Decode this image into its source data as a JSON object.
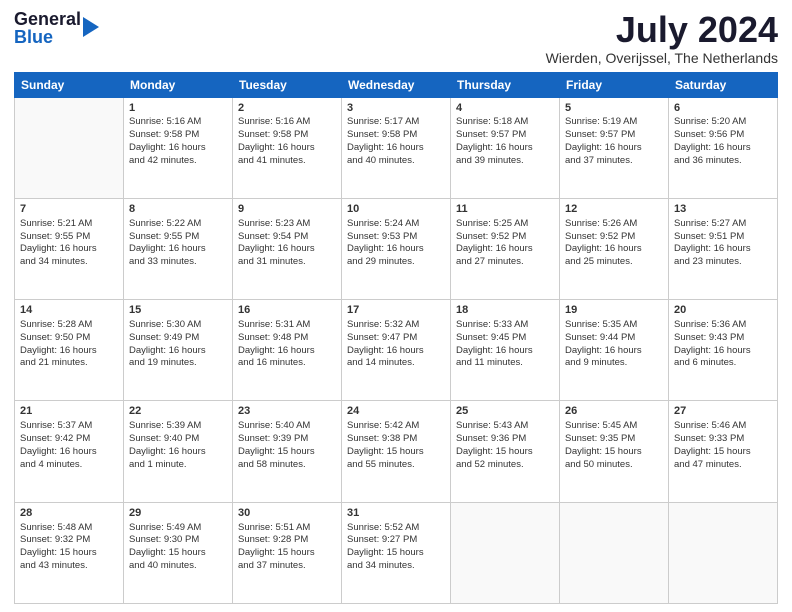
{
  "logo": {
    "general": "General",
    "blue": "Blue"
  },
  "title": "July 2024",
  "subtitle": "Wierden, Overijssel, The Netherlands",
  "days_of_week": [
    "Sunday",
    "Monday",
    "Tuesday",
    "Wednesday",
    "Thursday",
    "Friday",
    "Saturday"
  ],
  "weeks": [
    [
      {
        "day": "",
        "content": ""
      },
      {
        "day": "1",
        "content": "Sunrise: 5:16 AM\nSunset: 9:58 PM\nDaylight: 16 hours\nand 42 minutes."
      },
      {
        "day": "2",
        "content": "Sunrise: 5:16 AM\nSunset: 9:58 PM\nDaylight: 16 hours\nand 41 minutes."
      },
      {
        "day": "3",
        "content": "Sunrise: 5:17 AM\nSunset: 9:58 PM\nDaylight: 16 hours\nand 40 minutes."
      },
      {
        "day": "4",
        "content": "Sunrise: 5:18 AM\nSunset: 9:57 PM\nDaylight: 16 hours\nand 39 minutes."
      },
      {
        "day": "5",
        "content": "Sunrise: 5:19 AM\nSunset: 9:57 PM\nDaylight: 16 hours\nand 37 minutes."
      },
      {
        "day": "6",
        "content": "Sunrise: 5:20 AM\nSunset: 9:56 PM\nDaylight: 16 hours\nand 36 minutes."
      }
    ],
    [
      {
        "day": "7",
        "content": "Sunrise: 5:21 AM\nSunset: 9:55 PM\nDaylight: 16 hours\nand 34 minutes."
      },
      {
        "day": "8",
        "content": "Sunrise: 5:22 AM\nSunset: 9:55 PM\nDaylight: 16 hours\nand 33 minutes."
      },
      {
        "day": "9",
        "content": "Sunrise: 5:23 AM\nSunset: 9:54 PM\nDaylight: 16 hours\nand 31 minutes."
      },
      {
        "day": "10",
        "content": "Sunrise: 5:24 AM\nSunset: 9:53 PM\nDaylight: 16 hours\nand 29 minutes."
      },
      {
        "day": "11",
        "content": "Sunrise: 5:25 AM\nSunset: 9:52 PM\nDaylight: 16 hours\nand 27 minutes."
      },
      {
        "day": "12",
        "content": "Sunrise: 5:26 AM\nSunset: 9:52 PM\nDaylight: 16 hours\nand 25 minutes."
      },
      {
        "day": "13",
        "content": "Sunrise: 5:27 AM\nSunset: 9:51 PM\nDaylight: 16 hours\nand 23 minutes."
      }
    ],
    [
      {
        "day": "14",
        "content": "Sunrise: 5:28 AM\nSunset: 9:50 PM\nDaylight: 16 hours\nand 21 minutes."
      },
      {
        "day": "15",
        "content": "Sunrise: 5:30 AM\nSunset: 9:49 PM\nDaylight: 16 hours\nand 19 minutes."
      },
      {
        "day": "16",
        "content": "Sunrise: 5:31 AM\nSunset: 9:48 PM\nDaylight: 16 hours\nand 16 minutes."
      },
      {
        "day": "17",
        "content": "Sunrise: 5:32 AM\nSunset: 9:47 PM\nDaylight: 16 hours\nand 14 minutes."
      },
      {
        "day": "18",
        "content": "Sunrise: 5:33 AM\nSunset: 9:45 PM\nDaylight: 16 hours\nand 11 minutes."
      },
      {
        "day": "19",
        "content": "Sunrise: 5:35 AM\nSunset: 9:44 PM\nDaylight: 16 hours\nand 9 minutes."
      },
      {
        "day": "20",
        "content": "Sunrise: 5:36 AM\nSunset: 9:43 PM\nDaylight: 16 hours\nand 6 minutes."
      }
    ],
    [
      {
        "day": "21",
        "content": "Sunrise: 5:37 AM\nSunset: 9:42 PM\nDaylight: 16 hours\nand 4 minutes."
      },
      {
        "day": "22",
        "content": "Sunrise: 5:39 AM\nSunset: 9:40 PM\nDaylight: 16 hours\nand 1 minute."
      },
      {
        "day": "23",
        "content": "Sunrise: 5:40 AM\nSunset: 9:39 PM\nDaylight: 15 hours\nand 58 minutes."
      },
      {
        "day": "24",
        "content": "Sunrise: 5:42 AM\nSunset: 9:38 PM\nDaylight: 15 hours\nand 55 minutes."
      },
      {
        "day": "25",
        "content": "Sunrise: 5:43 AM\nSunset: 9:36 PM\nDaylight: 15 hours\nand 52 minutes."
      },
      {
        "day": "26",
        "content": "Sunrise: 5:45 AM\nSunset: 9:35 PM\nDaylight: 15 hours\nand 50 minutes."
      },
      {
        "day": "27",
        "content": "Sunrise: 5:46 AM\nSunset: 9:33 PM\nDaylight: 15 hours\nand 47 minutes."
      }
    ],
    [
      {
        "day": "28",
        "content": "Sunrise: 5:48 AM\nSunset: 9:32 PM\nDaylight: 15 hours\nand 43 minutes."
      },
      {
        "day": "29",
        "content": "Sunrise: 5:49 AM\nSunset: 9:30 PM\nDaylight: 15 hours\nand 40 minutes."
      },
      {
        "day": "30",
        "content": "Sunrise: 5:51 AM\nSunset: 9:28 PM\nDaylight: 15 hours\nand 37 minutes."
      },
      {
        "day": "31",
        "content": "Sunrise: 5:52 AM\nSunset: 9:27 PM\nDaylight: 15 hours\nand 34 minutes."
      },
      {
        "day": "",
        "content": ""
      },
      {
        "day": "",
        "content": ""
      },
      {
        "day": "",
        "content": ""
      }
    ]
  ]
}
